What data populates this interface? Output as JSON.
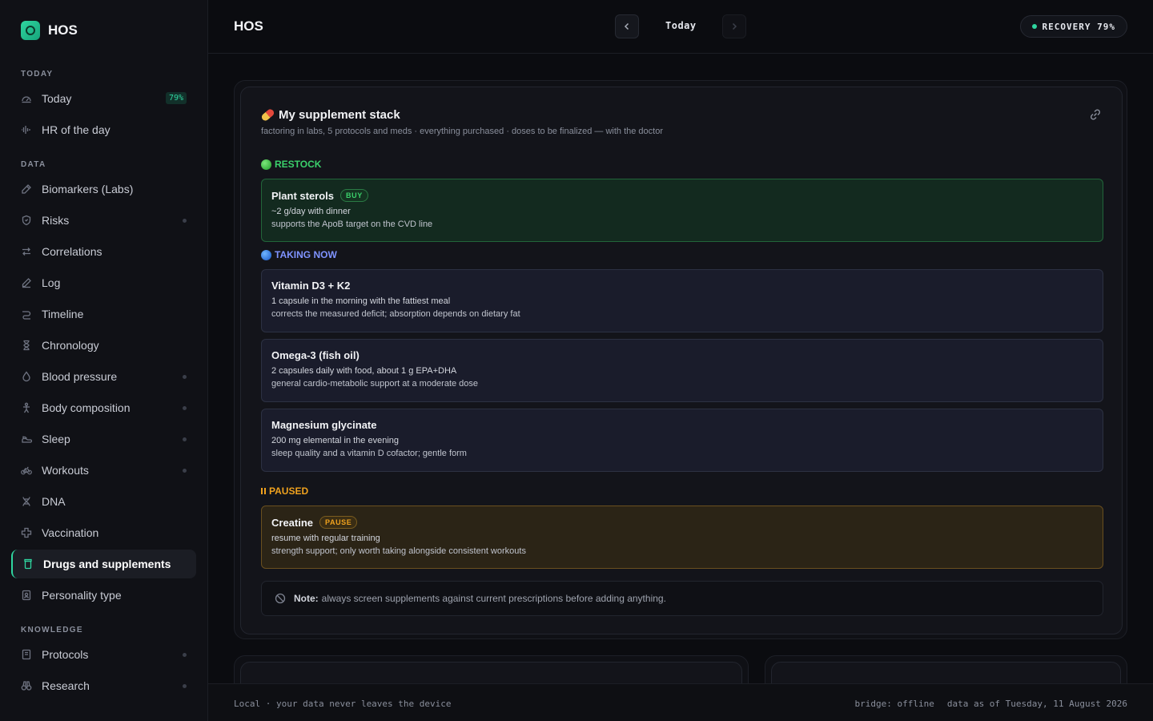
{
  "app": {
    "name": "HOS"
  },
  "sidebar": {
    "sections": {
      "today": "TODAY",
      "data": "DATA",
      "knowledge": "KNOWLEDGE"
    },
    "items": [
      {
        "label": "Today",
        "badge": "79%"
      },
      {
        "label": "HR of the day"
      },
      {
        "label": "Biomarkers (Labs)"
      },
      {
        "label": "Risks"
      },
      {
        "label": "Correlations"
      },
      {
        "label": "Log"
      },
      {
        "label": "Timeline"
      },
      {
        "label": "Chronology"
      },
      {
        "label": "Blood pressure"
      },
      {
        "label": "Body composition"
      },
      {
        "label": "Sleep"
      },
      {
        "label": "Workouts"
      },
      {
        "label": "DNA"
      },
      {
        "label": "Vaccination"
      },
      {
        "label": "Drugs and supplements"
      },
      {
        "label": "Personality type"
      },
      {
        "label": "Protocols"
      },
      {
        "label": "Research"
      }
    ]
  },
  "header": {
    "title": "HOS",
    "date_label": "Today",
    "recovery": "RECOVERY 79%"
  },
  "stack": {
    "title": "My supplement stack",
    "subtitle": "factoring in labs, 5 protocols and meds · everything purchased · doses to be finalized — with the doctor",
    "groups": {
      "restock": "RESTOCK",
      "taking": "TAKING NOW",
      "paused": "PAUSED"
    },
    "items": [
      {
        "name": "Plant sterols",
        "tag": "BUY",
        "dose": "~2 g/day with dinner",
        "note": "supports the ApoB target on the CVD line"
      },
      {
        "name": "Vitamin D3 + K2",
        "dose": "1 capsule in the morning with the fattiest meal",
        "note": "corrects the measured deficit; absorption depends on dietary fat"
      },
      {
        "name": "Omega-3 (fish oil)",
        "dose": "2 capsules daily with food, about 1 g EPA+DHA",
        "note": "general cardio-metabolic support at a moderate dose"
      },
      {
        "name": "Magnesium glycinate",
        "dose": "200 mg elemental in the evening",
        "note": "sleep quality and a vitamin D cofactor; gentle form"
      },
      {
        "name": "Creatine",
        "tag": "PAUSE",
        "dose": "resume with regular training",
        "note": "strength support; only worth taking alongside consistent workouts"
      }
    ],
    "note_label": "Note:",
    "note_text": "always screen supplements against current prescriptions before adding anything."
  },
  "footer": {
    "left": "Local · your data never leaves the device",
    "bridge": "bridge: offline",
    "data_as_of": "data as of Tuesday, 11 August 2026"
  },
  "colors": {
    "accent": "#2fd6a0",
    "restock": "#3bd06b",
    "taking": "#7f93ff",
    "paused": "#f0a21e"
  }
}
